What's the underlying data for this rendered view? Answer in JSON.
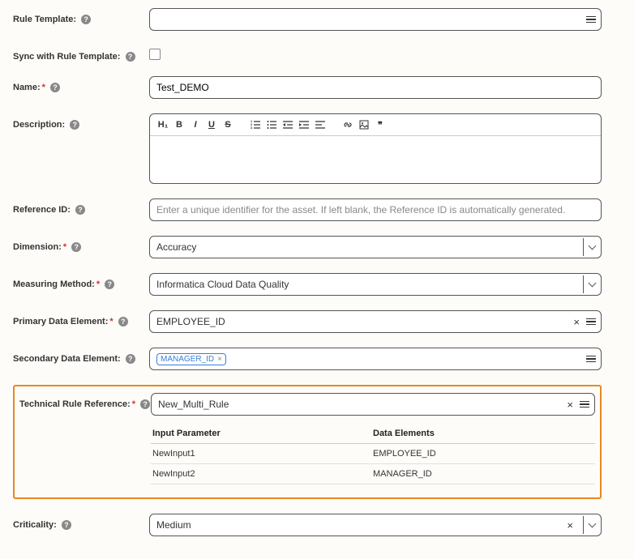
{
  "labels": {
    "rule_template": "Rule Template:",
    "sync": "Sync with Rule Template:",
    "name": "Name:",
    "description": "Description:",
    "reference_id": "Reference ID:",
    "dimension": "Dimension:",
    "measuring_method": "Measuring Method:",
    "primary_data_element": "Primary Data Element:",
    "secondary_data_element": "Secondary Data Element:",
    "technical_rule_reference": "Technical Rule Reference:",
    "criticality": "Criticality:"
  },
  "values": {
    "rule_template": "",
    "name": "Test_DEMO",
    "reference_id_placeholder": "Enter a unique identifier for the asset. If left blank, the Reference ID is automatically generated.",
    "dimension": "Accuracy",
    "measuring_method": "Informatica Cloud Data Quality",
    "primary_data_element": "EMPLOYEE_ID",
    "secondary_chip": "MANAGER_ID",
    "technical_rule_reference": "New_Multi_Rule",
    "criticality": "Medium"
  },
  "param_table": {
    "headers": {
      "c1": "Input Parameter",
      "c2": "Data Elements"
    },
    "rows": [
      {
        "c1": "NewInput1",
        "c2": "EMPLOYEE_ID"
      },
      {
        "c1": "NewInput2",
        "c2": "MANAGER_ID"
      }
    ]
  },
  "rte_buttons": {
    "h1": "H₁",
    "bold": "B",
    "italic": "I",
    "under": "U",
    "strike": "S",
    "quote": "❞"
  }
}
